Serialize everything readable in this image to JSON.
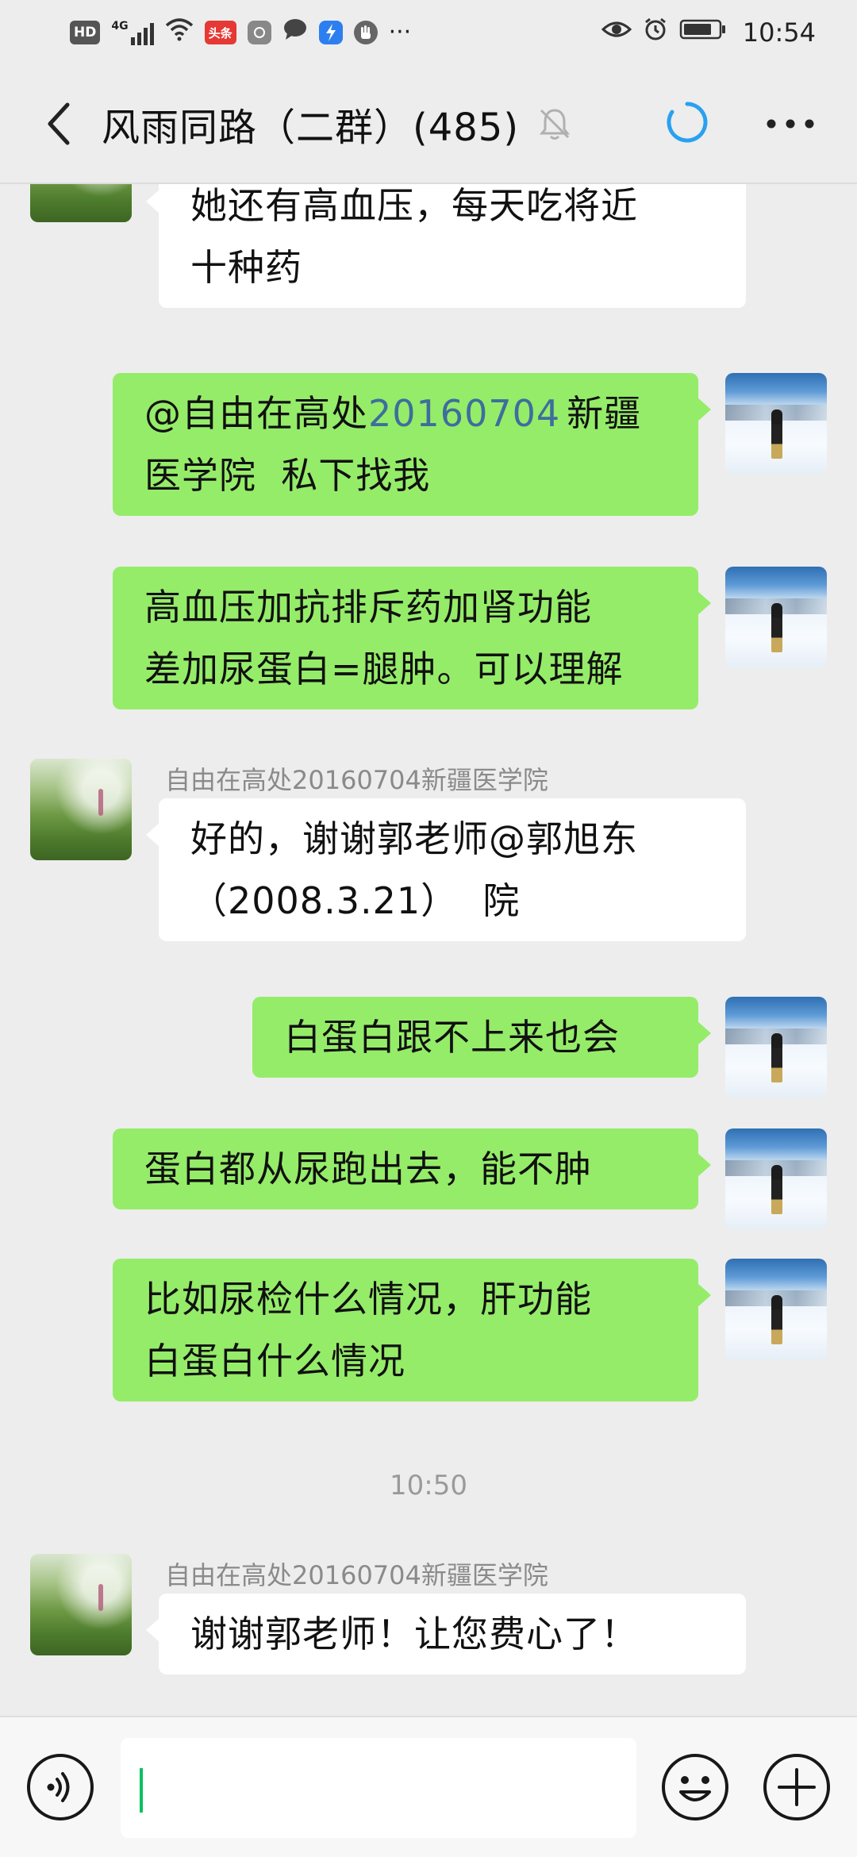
{
  "status_bar": {
    "left_icons": [
      "hd-icon",
      "4g-signal-icon",
      "wifi-icon",
      "toutiao-icon",
      "app-icon",
      "chat-bubble-icon",
      "lightning-app-icon",
      "hand-app-icon",
      "more-dots-icon"
    ],
    "hd": "HD",
    "network": "4G",
    "toutiao": "头条",
    "dots": "···",
    "time": "10:54"
  },
  "header": {
    "title": "风雨同路（二群）(485)",
    "icons": [
      "back-arrow-icon",
      "mute-bell-icon",
      "sync-ring-icon",
      "more-icon"
    ]
  },
  "messages": [
    {
      "side": "in",
      "sender": "",
      "lines": [
        "她还有高血压，每天吃将近",
        "十种药"
      ]
    },
    {
      "side": "out",
      "lines_html": true,
      "mention": "@自由在高处",
      "mention_link": "20160704",
      "rest_line1": "新疆",
      "line2": "医学院  私下找我"
    },
    {
      "side": "out",
      "lines": [
        "高血压加抗排斥药加肾功能",
        "差加尿蛋白=腿肿。可以理解"
      ]
    },
    {
      "side": "in",
      "sender": "自由在高处20160704新疆医学院",
      "lines": [
        "好的，谢谢郭老师@郭旭东",
        "（2008.3.21）  院"
      ]
    },
    {
      "side": "out",
      "lines": [
        "白蛋白跟不上来也会"
      ]
    },
    {
      "side": "out",
      "lines": [
        "蛋白都从尿跑出去，能不肿"
      ]
    },
    {
      "side": "out",
      "lines": [
        "比如尿检什么情况，肝功能",
        "白蛋白什么情况"
      ]
    },
    {
      "side": "in",
      "sender": "自由在高处20160704新疆医学院",
      "lines": [
        "谢谢郭老师！让您费心了！"
      ]
    }
  ],
  "timestamp": "10:50",
  "input": {
    "value": "",
    "placeholder": ""
  },
  "colors": {
    "background": "#ededed",
    "outgoing_bubble": "#95ec69",
    "incoming_bubble": "#ffffff",
    "mention_blue": "#3d6e9c",
    "sync_ring": "#29a1f0",
    "caret": "#07c160"
  }
}
